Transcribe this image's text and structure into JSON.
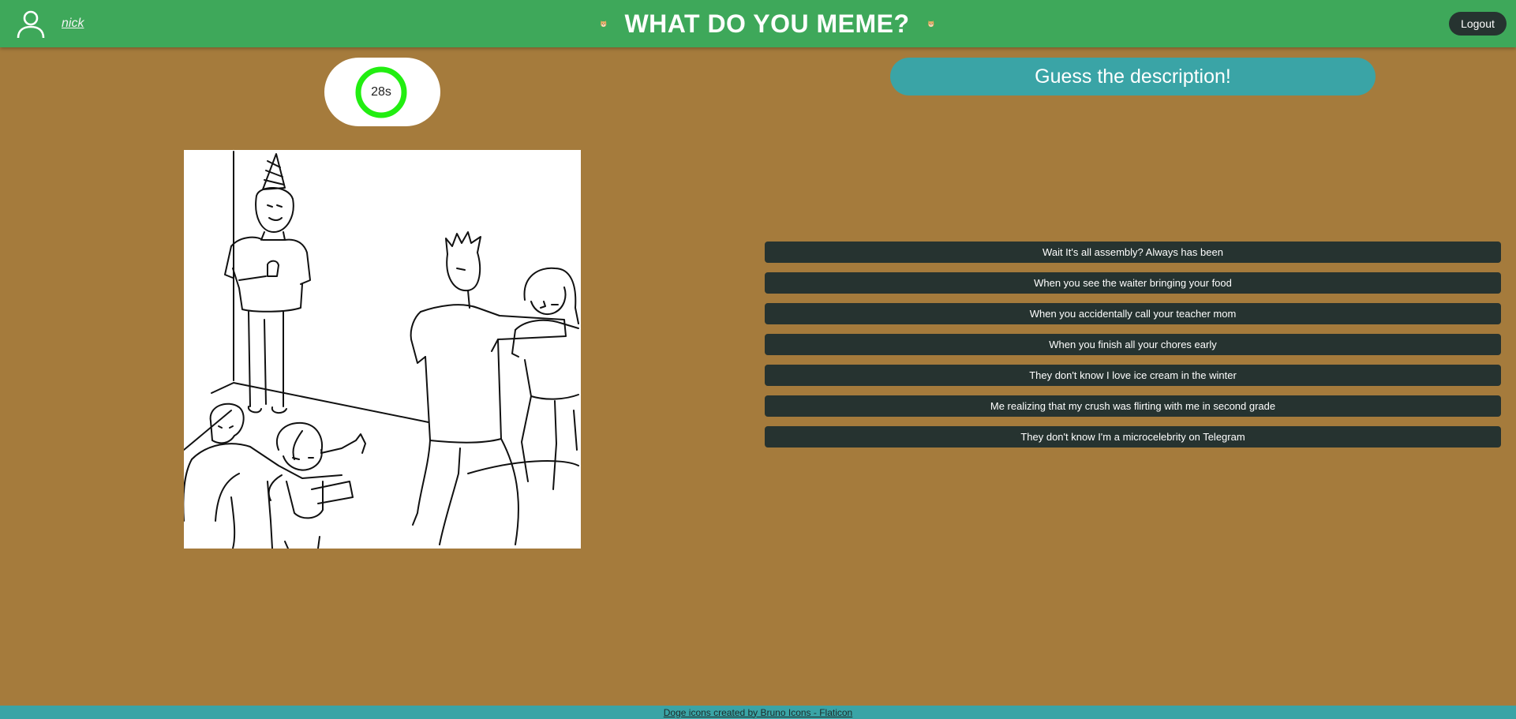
{
  "header": {
    "username": "nick",
    "title": "WHAT DO YOU MEME?",
    "logout_label": "Logout",
    "color": "#3ea85a"
  },
  "icons": {
    "user": "user-icon",
    "doge": "doge-icon"
  },
  "timer": {
    "label": "28s",
    "seconds_remaining": 28,
    "ring_color": "#22ee11"
  },
  "instruction": "Guess the description!",
  "captions": [
    "Wait It's all assembly? Always has been",
    "When you see the waiter bringing your food",
    "When you accidentally call your teacher mom",
    "When you finish all your chores early",
    "They don't know I love ice cream in the winter",
    "Me realizing that my crush was flirting with me in second grade",
    "They don't know I'm a microcelebrity on Telegram"
  ],
  "footer": {
    "credit": "Doge icons created by Bruno Icons - Flaticon"
  },
  "colors": {
    "background": "#a57b3c",
    "accent": "#3aa4a6",
    "button": "#263330"
  }
}
